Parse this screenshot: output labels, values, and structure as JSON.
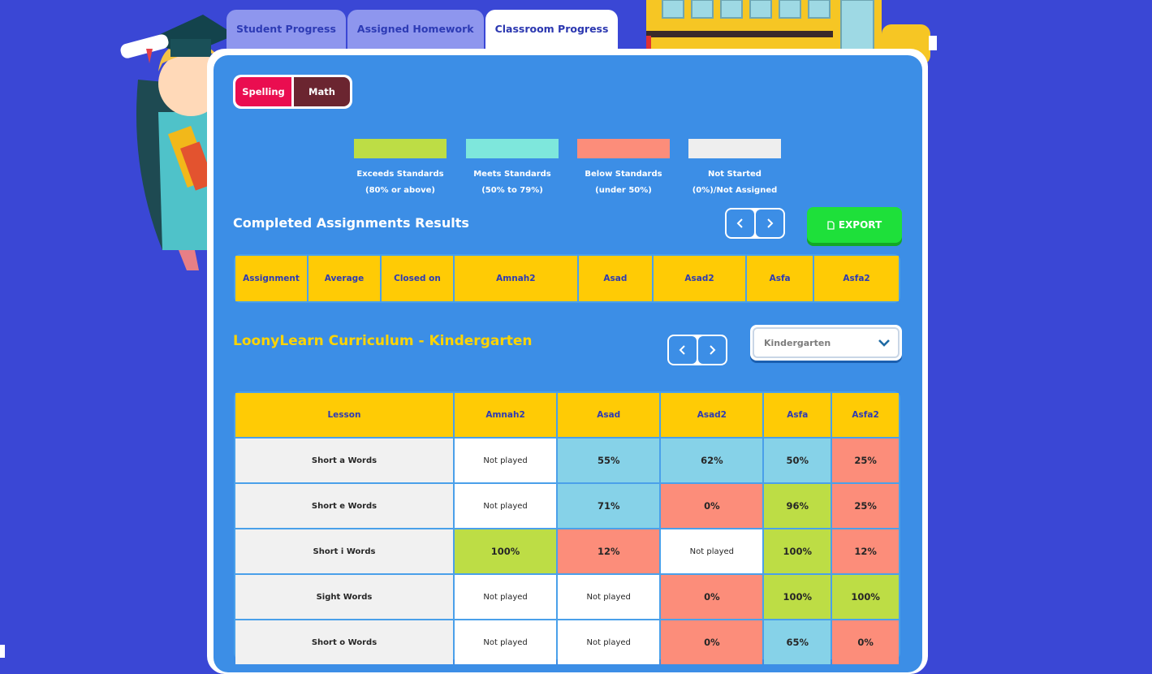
{
  "tabs": [
    {
      "label": "Student Progress",
      "active": false
    },
    {
      "label": "Assigned Homework",
      "active": false
    },
    {
      "label": "Classroom Progress",
      "active": true
    }
  ],
  "subjects": {
    "spelling": "Spelling",
    "math": "Math",
    "selected": "Spelling"
  },
  "legend": [
    {
      "label": "Exceeds Standards (80% or above)",
      "color": "#bddd45"
    },
    {
      "label": "Meets Standards (50% to 79%)",
      "color": "#7ee7dc"
    },
    {
      "label": "Below Standards (under 50%)",
      "color": "#fc8d7a"
    },
    {
      "label": "Not Started (0%)/Not Assigned",
      "color": "#eeeeee"
    }
  ],
  "completed": {
    "title": "Completed Assignments Results",
    "export_label": "EXPORT",
    "headers": [
      "Assignment",
      "Average",
      "Closed on",
      "Amnah2",
      "Asad",
      "Asad2",
      "Asfa",
      "Asfa2"
    ]
  },
  "curriculum": {
    "title": "LoonyLearn Curriculum - Kindergarten",
    "grade_select": "Kindergarten",
    "headers": [
      "Lesson",
      "Amnah2",
      "Asad",
      "Asad2",
      "Asfa",
      "Asfa2"
    ],
    "rows": [
      {
        "lesson": "Short a Words",
        "cells": [
          {
            "v": "Not played",
            "s": "np"
          },
          {
            "v": "55%",
            "s": "meets"
          },
          {
            "v": "62%",
            "s": "meets"
          },
          {
            "v": "50%",
            "s": "meets"
          },
          {
            "v": "25%",
            "s": "below"
          }
        ]
      },
      {
        "lesson": "Short e Words",
        "cells": [
          {
            "v": "Not played",
            "s": "np"
          },
          {
            "v": "71%",
            "s": "meets"
          },
          {
            "v": "0%",
            "s": "below"
          },
          {
            "v": "96%",
            "s": "exceeds"
          },
          {
            "v": "25%",
            "s": "below"
          }
        ]
      },
      {
        "lesson": "Short i Words",
        "cells": [
          {
            "v": "100%",
            "s": "exceeds"
          },
          {
            "v": "12%",
            "s": "below"
          },
          {
            "v": "Not played",
            "s": "np"
          },
          {
            "v": "100%",
            "s": "exceeds"
          },
          {
            "v": "12%",
            "s": "below"
          }
        ]
      },
      {
        "lesson": "Sight Words",
        "cells": [
          {
            "v": "Not played",
            "s": "np"
          },
          {
            "v": "Not played",
            "s": "np"
          },
          {
            "v": "0%",
            "s": "below"
          },
          {
            "v": "100%",
            "s": "exceeds"
          },
          {
            "v": "100%",
            "s": "exceeds"
          }
        ]
      },
      {
        "lesson": "Short o Words",
        "cells": [
          {
            "v": "Not played",
            "s": "np"
          },
          {
            "v": "Not played",
            "s": "np"
          },
          {
            "v": "0%",
            "s": "below"
          },
          {
            "v": "65%",
            "s": "meets"
          },
          {
            "v": "0%",
            "s": "below"
          }
        ]
      }
    ]
  }
}
